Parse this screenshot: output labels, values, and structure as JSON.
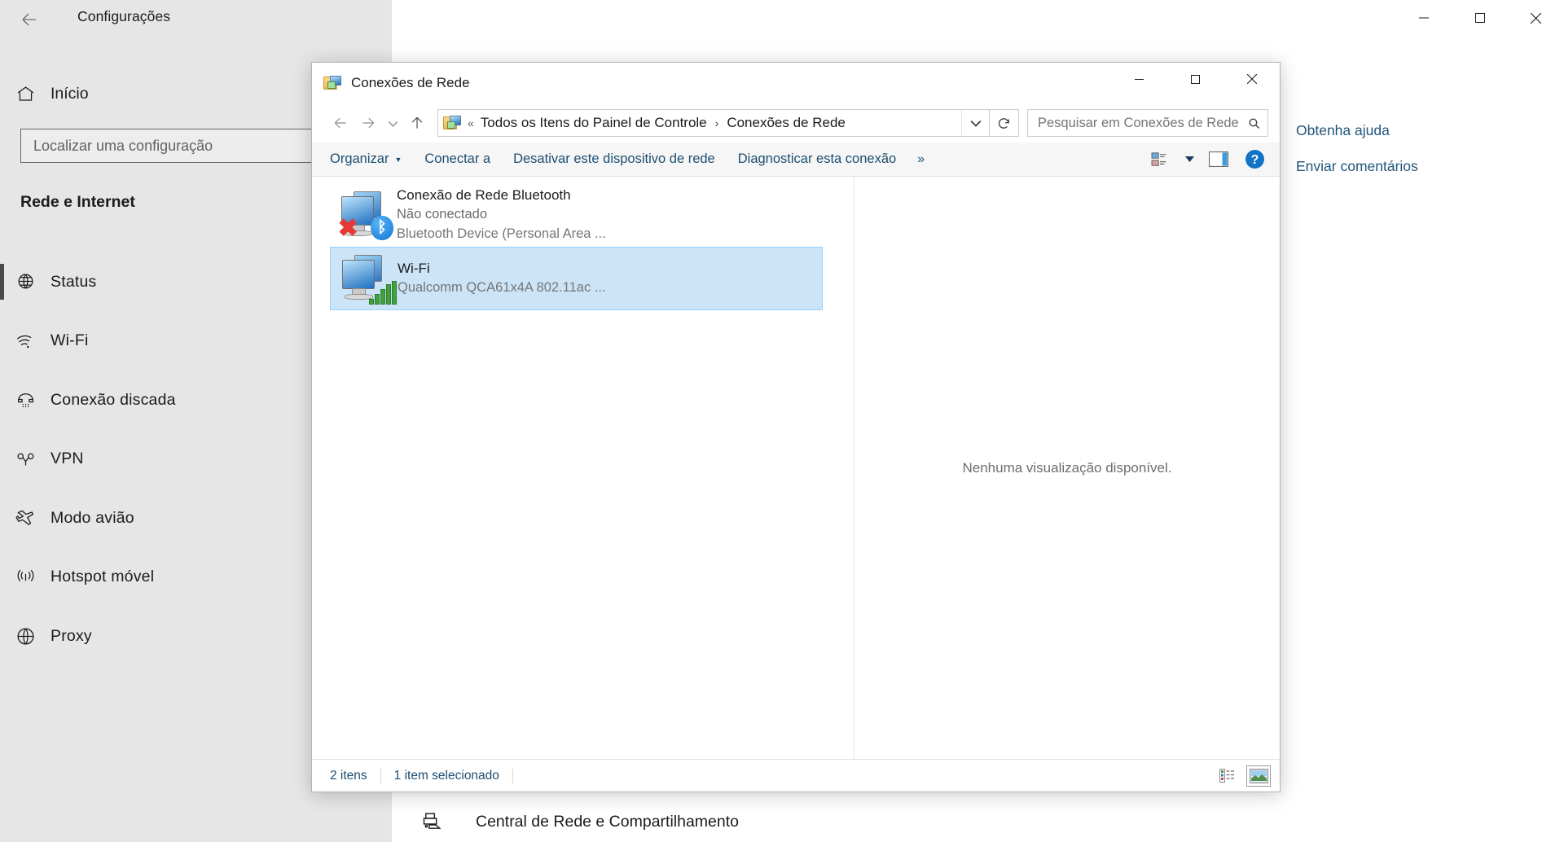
{
  "settings": {
    "title": "Configurações",
    "back_label": "Voltar",
    "home_label": "Início",
    "search_placeholder": "Localizar uma configuração",
    "search_value": "",
    "section_heading": "Rede e Internet",
    "nav_items": [
      {
        "label": "Status",
        "icon": "globe-grid-icon",
        "selected": true
      },
      {
        "label": "Wi-Fi",
        "icon": "wifi-icon",
        "selected": false
      },
      {
        "label": "Conexão discada",
        "icon": "dialup-icon",
        "selected": false
      },
      {
        "label": "VPN",
        "icon": "vpn-key-icon",
        "selected": false
      },
      {
        "label": "Modo avião",
        "icon": "airplane-icon",
        "selected": false
      },
      {
        "label": "Hotspot móvel",
        "icon": "hotspot-icon",
        "selected": false
      },
      {
        "label": "Proxy",
        "icon": "globe-icon",
        "selected": false
      }
    ],
    "right_links": [
      "Obtenha ajuda",
      "Enviar comentários"
    ],
    "bottom_link": "Central de Rede e Compartilhamento",
    "window_buttons": {
      "minimize": "Minimizar",
      "maximize": "Maximizar",
      "close": "Fechar"
    }
  },
  "explorer": {
    "title": "Conexões de Rede",
    "window_buttons": {
      "minimize": "Minimizar",
      "maximize": "Maximizar",
      "close": "Fechar"
    },
    "nav": {
      "back": "Voltar",
      "forward": "Avançar",
      "recent": "Locais recentes",
      "up": "Acima"
    },
    "breadcrumb": {
      "overflow": "«",
      "separator": "›",
      "items": [
        "Todos os Itens do Painel de Controle",
        "Conexões de Rede"
      ]
    },
    "refresh_label": "Atualizar",
    "search": {
      "placeholder": "Pesquisar em Conexões de Rede",
      "value": ""
    },
    "toolbar": {
      "organize": "Organizar",
      "connect": "Conectar a",
      "disable": "Desativar este dispositivo de rede",
      "diagnose": "Diagnosticar esta conexão",
      "overflow": "»",
      "view_label": "Alterar modo de exibição",
      "preview_pane_label": "Painel de visualização",
      "help_label": "Ajuda"
    },
    "items": [
      {
        "name": "Conexão de Rede Bluetooth",
        "status": "Não conectado",
        "device": "Bluetooth Device (Personal Area ...",
        "icon": "network-adapter-bluetooth-icon",
        "selected": false
      },
      {
        "name": "Wi-Fi",
        "status": "",
        "device": "Qualcomm QCA61x4A 802.11ac ...",
        "icon": "network-adapter-wifi-icon",
        "selected": true
      }
    ],
    "preview": {
      "empty_text": "Nenhuma visualização disponível."
    },
    "status_bar": {
      "count": "2 itens",
      "selection": "1 item selecionado",
      "details_view_label": "Exibir detalhes",
      "large_icons_view_label": "Exibir ícones grandes"
    }
  },
  "colors": {
    "accent_link": "#1d4e72",
    "settings_link": "#21557c",
    "selection": "#cce4f7",
    "selection_border": "#99d1ff",
    "sidebar_bg": "#e6e6e6",
    "toolbar_bg": "#f6f6f6"
  }
}
